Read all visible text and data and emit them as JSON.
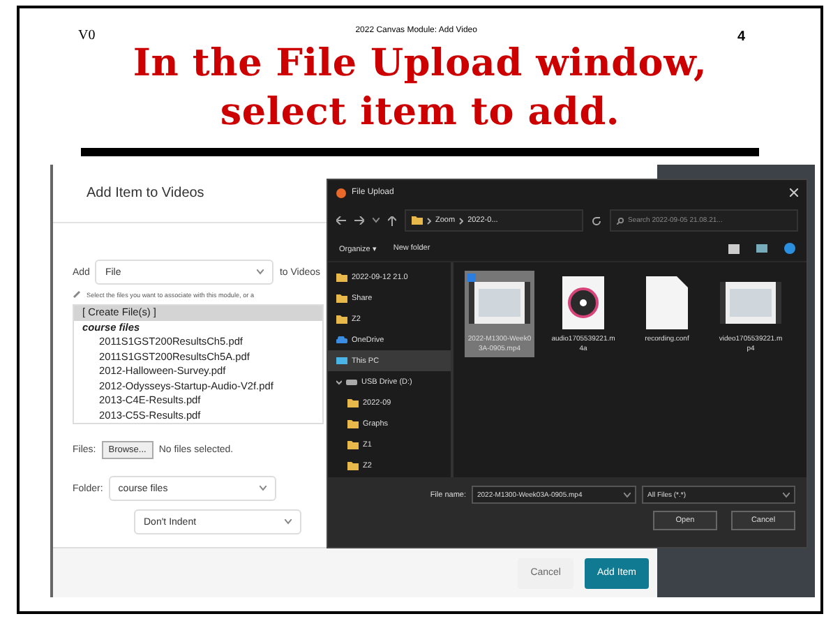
{
  "header": {
    "version": "V0",
    "doc_title": "2022 Canvas Module: Add Video",
    "page_number": "4"
  },
  "heading": [
    "In the File Upload window,",
    "select item to add."
  ],
  "canvas_dialog": {
    "title": "Add Item to Videos",
    "add_label": "Add",
    "add_type": "File",
    "to_label": "to Videos",
    "hint": "Select the files you want to associate with this module, or a",
    "file_list": [
      {
        "text": "[ Create File(s) ]",
        "kind": "action",
        "selected": true
      },
      {
        "text": "course files",
        "kind": "folder",
        "selected": false
      },
      {
        "text": "2011S1GST200ResultsCh5.pdf",
        "kind": "file",
        "selected": false
      },
      {
        "text": "2011S1GST200ResultsCh5A.pdf",
        "kind": "file",
        "selected": false
      },
      {
        "text": "2012-Halloween-Survey.pdf",
        "kind": "file",
        "selected": false
      },
      {
        "text": "2012-Odysseys-Startup-Audio-V2f.pdf",
        "kind": "file",
        "selected": false
      },
      {
        "text": "2013-C4E-Results.pdf",
        "kind": "file",
        "selected": false
      },
      {
        "text": "2013-C5S-Results.pdf",
        "kind": "file",
        "selected": false
      }
    ],
    "files_label": "Files:",
    "browse_button": "Browse...",
    "no_file": "No files selected.",
    "folder_label": "Folder:",
    "folder_value": "course files",
    "indent_value": "Don't Indent",
    "buttons": [
      {
        "label": "Cancel",
        "kind": "secondary"
      },
      {
        "label": "Add Item",
        "kind": "primary"
      }
    ]
  },
  "file_upload": {
    "title": "File Upload",
    "breadcrumb": [
      "Zoom",
      "2022-0..."
    ],
    "search_placeholder": "Search 2022-09-05 21.08.21...",
    "toolbar": [
      "Organize ▾",
      "New folder"
    ],
    "tree": [
      {
        "label": "2022-09-12 21.0",
        "kind": "folder",
        "selected": false
      },
      {
        "label": "Share",
        "kind": "folder",
        "selected": false
      },
      {
        "label": "Z2",
        "kind": "folder",
        "selected": false
      },
      {
        "label": "OneDrive",
        "kind": "cloud",
        "selected": false
      },
      {
        "label": "This PC",
        "kind": "pc",
        "selected": true
      },
      {
        "label": "USB Drive (D:)",
        "kind": "drive",
        "selected": false,
        "expanded": true,
        "children": [
          {
            "label": "2022-09",
            "kind": "folder",
            "selected": false
          },
          {
            "label": "Graphs",
            "kind": "folder",
            "selected": false
          },
          {
            "label": "Z1",
            "kind": "folder",
            "selected": false
          },
          {
            "label": "Z2",
            "kind": "folder",
            "selected": false
          }
        ]
      }
    ],
    "items": [
      {
        "name": "2022-M1300-Week03A-0905.mp4",
        "kind": "video",
        "selected": true
      },
      {
        "name": "audio1705539221.m4a",
        "kind": "audio",
        "selected": false
      },
      {
        "name": "recording.conf",
        "kind": "document",
        "selected": false
      },
      {
        "name": "video1705539221.mp4",
        "kind": "video",
        "selected": false
      }
    ],
    "file_name_label": "File name:",
    "file_name_value": "2022-M1300-Week03A-0905.mp4",
    "filter_value": "All Files (*.*)",
    "buttons": [
      "Open",
      "Cancel"
    ]
  }
}
